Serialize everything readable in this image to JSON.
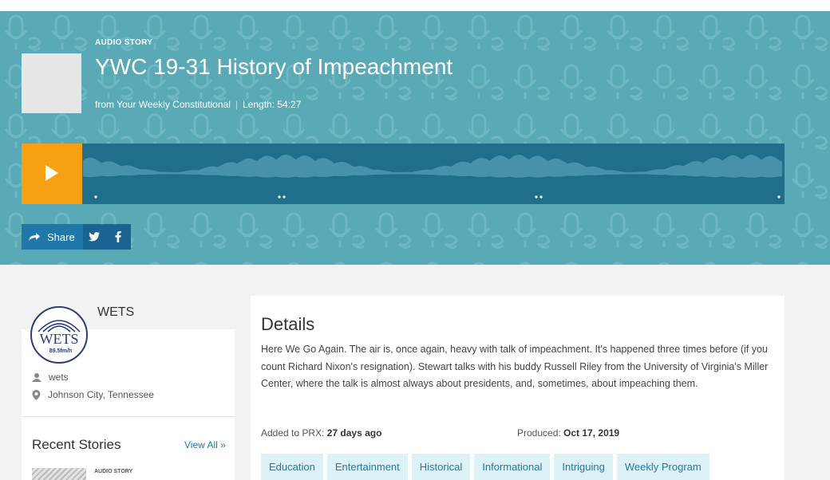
{
  "story": {
    "kicker": "AUDIO STORY",
    "title": "YWC 19-31 History of Impeachment",
    "from_text": "from Your Weekly Constitutional",
    "length_text": "Length: 54:27"
  },
  "player": {
    "play_icon": "play-icon",
    "colors": {
      "play_bg": "#f6a012",
      "track_bg": "#1f6f8b"
    }
  },
  "share": {
    "label": "Share",
    "twitter_icon": "twitter-icon",
    "facebook_icon": "facebook-icon"
  },
  "station": {
    "name": "WETS",
    "logo_text": "WETS",
    "logo_sub": "89.5fm/h",
    "user": "wets",
    "location": "Johnson City, Tennessee"
  },
  "recent": {
    "title": "Recent Stories",
    "view_all": "View All »",
    "first_kicker": "AUDIO STORY"
  },
  "details": {
    "title": "Details",
    "description": "Here We Go Again. The air is, once again, heavy with talk of impeachment. It's happened three times before (if you count Richard Nixon's resignation). Stewart talks with his buddy Russell Riley from the University of Virginia's Miller Center, where the talk is almost always about presidents, and, sometimes, about impeaching them.",
    "added_label": "Added to PRX:",
    "added_value": "27 days ago",
    "produced_label": "Produced:",
    "produced_value": "Oct 17, 2019",
    "tags": [
      "Education",
      "Entertainment",
      "Historical",
      "Informational",
      "Intriguing",
      "Weekly Program"
    ]
  }
}
